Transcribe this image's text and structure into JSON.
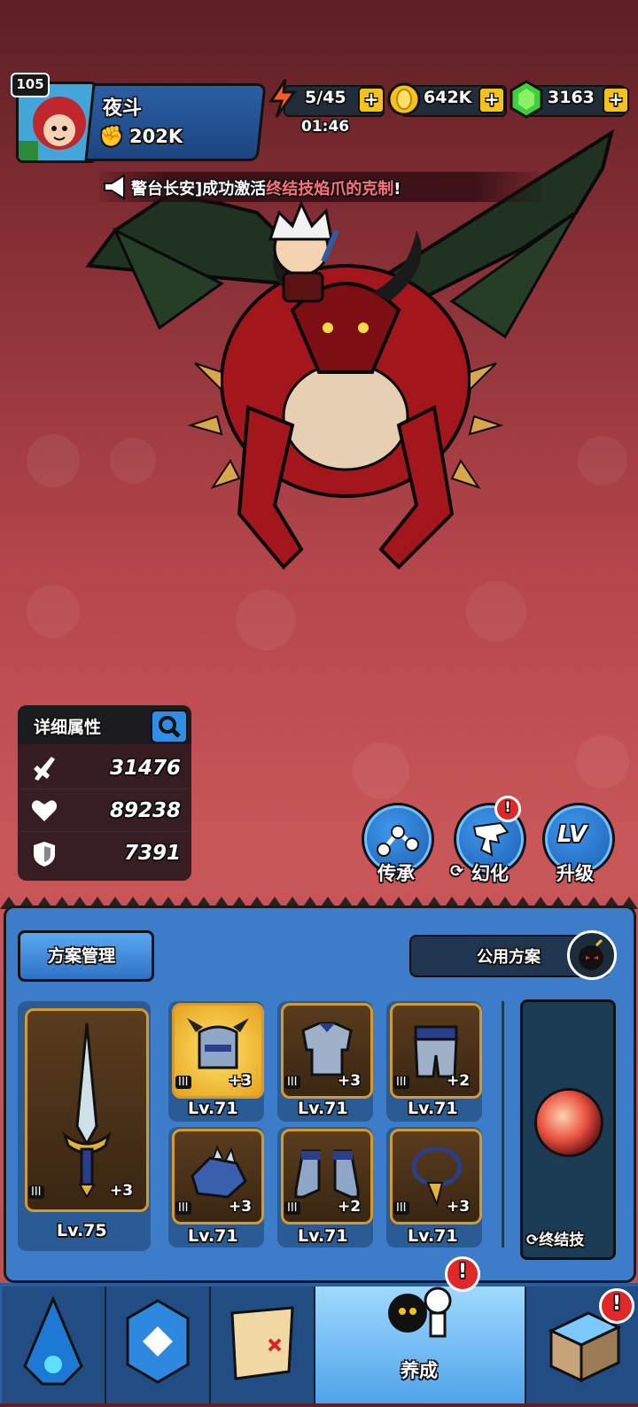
{
  "player": {
    "level": "105",
    "name": "夜斗",
    "power": "202K"
  },
  "resources": {
    "stamina": "5/45",
    "stamina_timer": "01:46",
    "gold": "642K",
    "gems": "3163",
    "plus_symbol": "+"
  },
  "announcement": {
    "prefix": "警台长安]成功激活",
    "highlight": "终结技焰爪的克制",
    "suffix": "!"
  },
  "stats": {
    "title": "详细属性",
    "attack": "31476",
    "health": "89238",
    "defense": "7391"
  },
  "actions": {
    "inherit": "传承",
    "transform": "幻化",
    "upgrade": "升级",
    "upgrade_icon_text": "LV"
  },
  "panel": {
    "plan_manage": "方案管理",
    "shared_plan": "公用方案",
    "finisher": "终结技",
    "tier": "III",
    "weapon": {
      "plus": "+3",
      "level": "Lv.75"
    },
    "equipment": [
      {
        "name": "helmet",
        "plus": "+3",
        "level": "Lv.71"
      },
      {
        "name": "chest",
        "plus": "+3",
        "level": "Lv.71"
      },
      {
        "name": "pants",
        "plus": "+2",
        "level": "Lv.71"
      },
      {
        "name": "gloves",
        "plus": "+3",
        "level": "Lv.71"
      },
      {
        "name": "boots",
        "plus": "+2",
        "level": "Lv.71"
      },
      {
        "name": "necklace",
        "plus": "+3",
        "level": "Lv.71"
      }
    ]
  },
  "nav": {
    "active_label": "养成",
    "alert_symbol": "!"
  },
  "colors": {
    "accent_blue": "#3d7cc9",
    "gold": "#f4c21d",
    "highlight_red": "#ff6f7a",
    "alert_red": "#e02828"
  }
}
